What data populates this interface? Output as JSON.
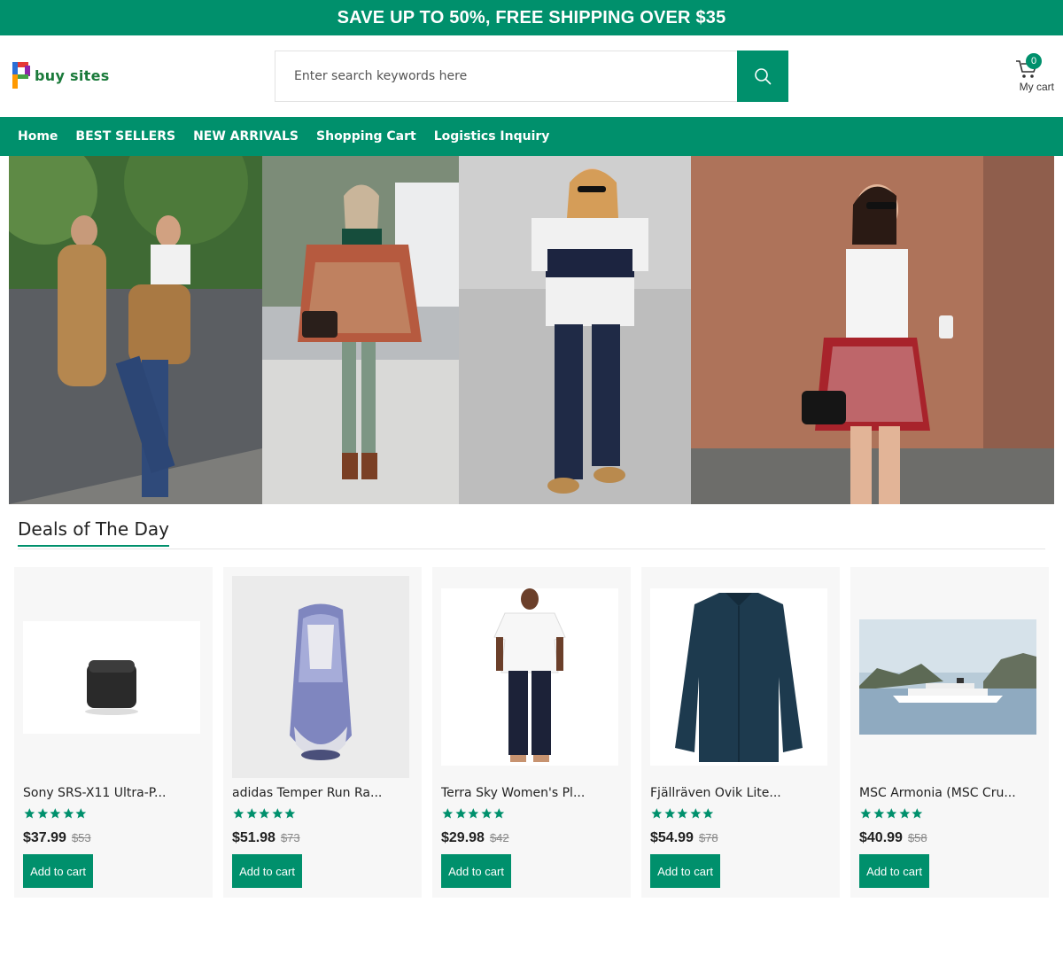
{
  "promo": {
    "text": "SAVE UP TO 50%, FREE SHIPPING OVER $35"
  },
  "brand": {
    "name": "buy sites",
    "accent": "#00906c"
  },
  "search": {
    "placeholder": "Enter search keywords here",
    "button_icon": "search-icon"
  },
  "cart": {
    "count": "0",
    "label": "My cart",
    "icon": "cart-icon"
  },
  "nav": {
    "items": [
      "Home",
      "BEST SELLERS",
      "NEW ARRIVALS",
      "Shopping Cart",
      "Logistics Inquiry"
    ]
  },
  "deals": {
    "title": "Deals of The Day"
  },
  "products": [
    {
      "name": "Sony SRS-X11 Ultra-P...",
      "price": "$37.99",
      "old_price": "$53",
      "rating": 5,
      "cta": "Add to cart"
    },
    {
      "name": "adidas Temper Run Ra...",
      "price": "$51.98",
      "old_price": "$73",
      "rating": 5,
      "cta": "Add to cart"
    },
    {
      "name": "Terra Sky Women's Pl...",
      "price": "$29.98",
      "old_price": "$42",
      "rating": 5,
      "cta": "Add to cart"
    },
    {
      "name": "Fjällräven Övik Lite...",
      "price": "$54.99",
      "old_price": "$78",
      "rating": 5,
      "cta": "Add to cart"
    },
    {
      "name": "MSC Armonia (MSC Cru...",
      "price": "$40.99",
      "old_price": "$58",
      "rating": 5,
      "cta": "Add to cart"
    }
  ]
}
